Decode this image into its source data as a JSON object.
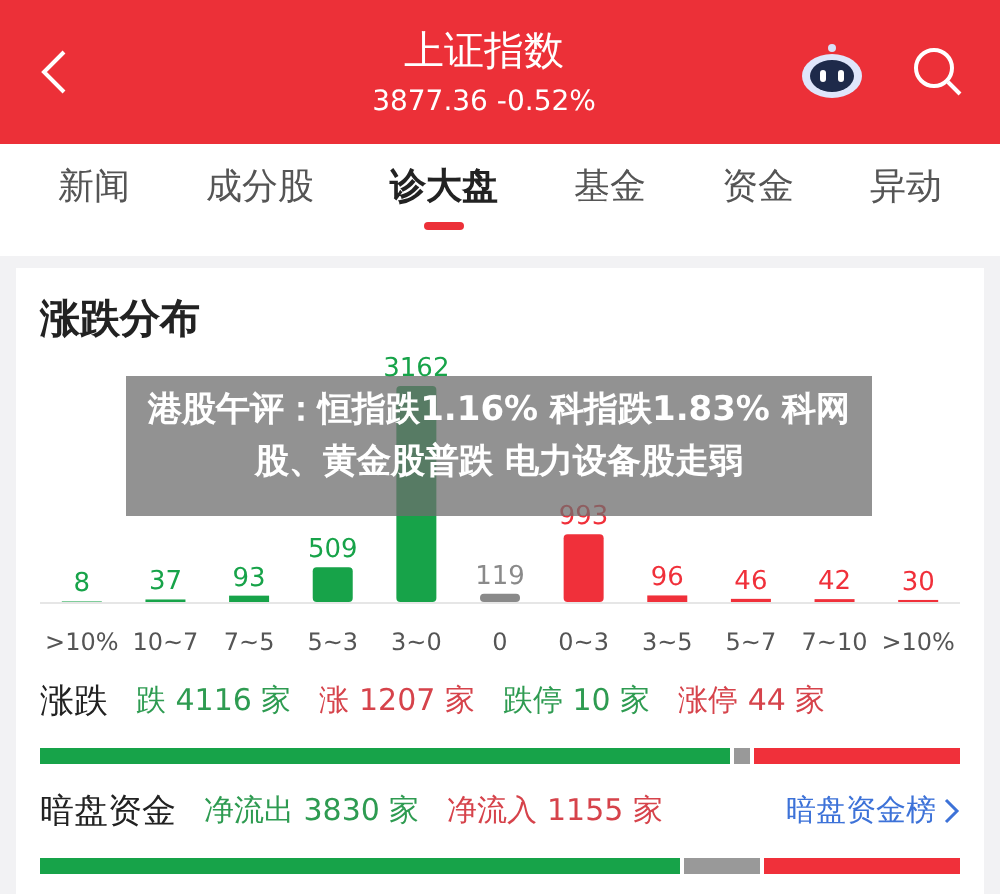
{
  "header": {
    "title": "上证指数",
    "subtitle": "3877.36 -0.52%"
  },
  "tabs": [
    {
      "label": "新闻",
      "selected": false
    },
    {
      "label": "成分股",
      "selected": false
    },
    {
      "label": "诊大盘",
      "selected": true
    },
    {
      "label": "基金",
      "selected": false
    },
    {
      "label": "资金",
      "selected": false
    },
    {
      "label": "异动",
      "selected": false
    }
  ],
  "distribution": {
    "title": "涨跌分布",
    "chart_data": {
      "type": "bar",
      "categories": [
        ">10%",
        "10~7",
        "7~5",
        "5~3",
        "3~0",
        "0",
        "0~3",
        "3~5",
        "5~7",
        "7~10",
        ">10%"
      ],
      "data_labels": true,
      "values": [
        8,
        37,
        93,
        509,
        3162,
        119,
        993,
        96,
        46,
        42,
        30
      ]
    }
  },
  "breadth": {
    "label": "涨跌",
    "stats": [
      {
        "kind": "down",
        "text": "跌 4116 家"
      },
      {
        "kind": "up",
        "text": "涨 1207 家"
      },
      {
        "kind": "down",
        "text": "跌停 10 家"
      },
      {
        "kind": "up",
        "text": "涨停 44 家"
      }
    ],
    "fills": [
      {
        "kind": "flat",
        "level": 0.775
      },
      {
        "kind": "down",
        "level": 0.755
      }
    ]
  },
  "dark_pool": {
    "label": "暗盘资金",
    "stats": [
      {
        "kind": "down",
        "text": "净流出 3830 家"
      },
      {
        "kind": "up",
        "text": "净流入 1155 家"
      }
    ],
    "link": "暗盘资金榜",
    "fills": [
      {
        "kind": "flat",
        "level": 0.788
      },
      {
        "kind": "down",
        "level": 0.7
      }
    ]
  },
  "headline_banner": {
    "text": "港股午评：恒指跌1.16% 科指跌1.83% 科网股、黄金股普跌 电力设备股走弱"
  }
}
